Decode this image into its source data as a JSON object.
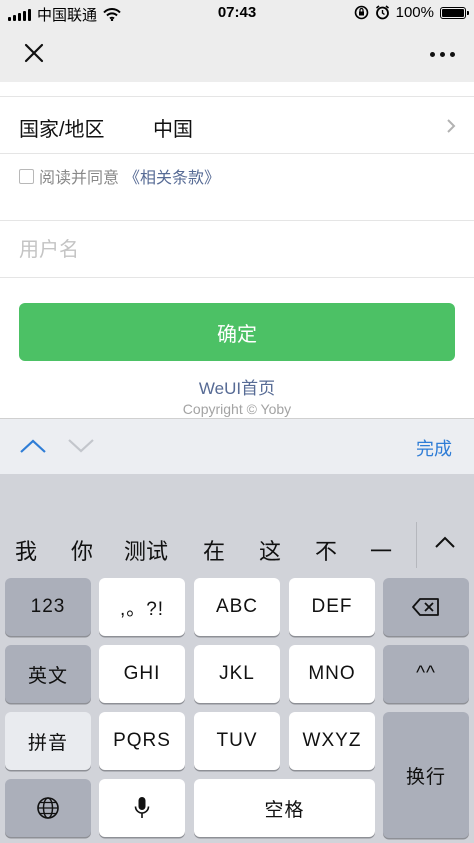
{
  "status_bar": {
    "carrier": "中国联通",
    "time": "07:43",
    "battery": "100%"
  },
  "form": {
    "country_label": "国家/地区",
    "country_value": "中国",
    "agree_text": "阅读并同意",
    "agree_link": "《相关条款》",
    "username_placeholder": "用户名",
    "username_value": "",
    "confirm_label": "确定",
    "weui_link": "WeUI首页",
    "copyright": "Copyright © Yoby"
  },
  "toolbar": {
    "done_label": "完成"
  },
  "keyboard": {
    "candidates": [
      "我",
      "你",
      "测试",
      "在",
      "这",
      "不",
      "一"
    ],
    "keys": {
      "num": "123",
      "punct": ",。?!",
      "abc": "ABC",
      "def": "DEF",
      "english": "英文",
      "ghi": "GHI",
      "jkl": "JKL",
      "mno": "MNO",
      "emoji": "^^",
      "pinyin": "拼音",
      "pqrs": "PQRS",
      "tuv": "TUV",
      "wxyz": "WXYZ",
      "enter": "换行",
      "space": "空格"
    }
  },
  "icons": {
    "close": "close-icon",
    "more": "more-icon",
    "chevron_right": "chevron-right-icon",
    "wifi": "wifi-icon",
    "backspace": "backspace-icon",
    "globe": "globe-icon",
    "microphone": "microphone-icon"
  },
  "colors": {
    "primary_green": "#4cc165",
    "link_blue": "#576b95",
    "done_blue": "#2f7dd6"
  }
}
